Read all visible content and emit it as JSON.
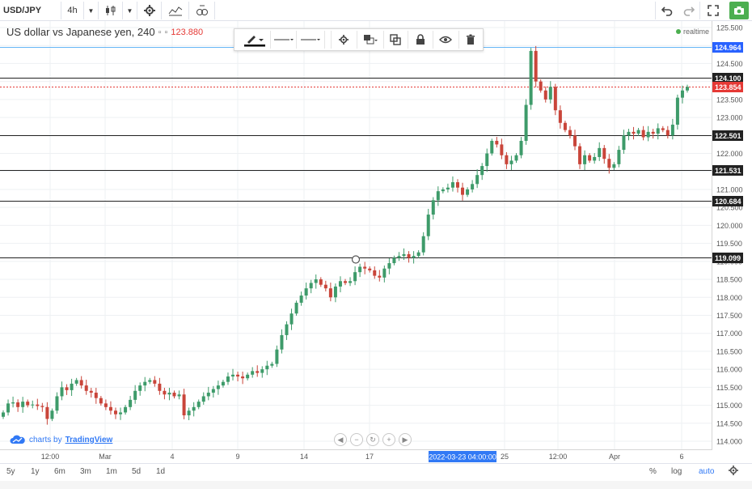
{
  "toolbar": {
    "symbol": "USD/JPY",
    "resolution": "4h"
  },
  "header": {
    "title": "US dollar vs Japanese yen, 240",
    "last_price": "123.880",
    "realtime": "realtime"
  },
  "watermark": {
    "prefix": "charts by",
    "brand": "TradingView"
  },
  "date_badge": "2022-03-23 04:00:00",
  "bottom": {
    "ranges": [
      "5y",
      "1y",
      "6m",
      "3m",
      "1m",
      "5d",
      "1d"
    ],
    "percent": "%",
    "log": "log",
    "auto": "auto"
  },
  "colors": {
    "up": "#3e9b6a",
    "down": "#c9453a",
    "accent": "#3179f5",
    "snapshot": "#4caf50"
  },
  "chart_data": {
    "type": "candlestick",
    "symbol": "USD/JPY",
    "interval": "240",
    "ylim": [
      113.85,
      125.6
    ],
    "yticks": [
      "125.500",
      "125.000",
      "124.500",
      "124.000",
      "123.500",
      "123.000",
      "122.500",
      "122.000",
      "121.500",
      "121.000",
      "120.500",
      "120.000",
      "119.500",
      "119.000",
      "118.500",
      "118.000",
      "117.500",
      "117.000",
      "116.500",
      "116.000",
      "115.500",
      "115.000",
      "114.500",
      "114.000"
    ],
    "xticks": [
      "12:00",
      "Mar",
      "4",
      "9",
      "14",
      "17",
      "25",
      "12:00",
      "Apr",
      "6"
    ],
    "horizontal_lines": [
      {
        "value": 124.964,
        "label": "124.964",
        "style": "blue"
      },
      {
        "value": 124.1,
        "label": "124.100",
        "style": "dark"
      },
      {
        "value": 123.854,
        "label": "123.854",
        "style": "last"
      },
      {
        "value": 122.501,
        "label": "122.501",
        "style": "dark"
      },
      {
        "value": 121.531,
        "label": "121.531",
        "style": "dark"
      },
      {
        "value": 120.684,
        "label": "120.684",
        "style": "dark"
      },
      {
        "value": 119.099,
        "label": "119.099",
        "style": "dark"
      }
    ],
    "closes": [
      114.8,
      115.05,
      115.08,
      114.95,
      115.1,
      115.0,
      115.02,
      114.98,
      114.95,
      114.62,
      114.85,
      115.25,
      115.5,
      115.42,
      115.6,
      115.7,
      115.55,
      115.4,
      115.35,
      115.2,
      115.05,
      114.95,
      114.85,
      114.75,
      114.8,
      114.95,
      115.15,
      115.4,
      115.55,
      115.65,
      115.7,
      115.6,
      115.4,
      115.3,
      115.35,
      115.25,
      115.3,
      114.72,
      114.85,
      114.95,
      115.1,
      115.25,
      115.35,
      115.45,
      115.55,
      115.65,
      115.8,
      115.85,
      115.8,
      115.75,
      115.85,
      115.95,
      115.9,
      116.0,
      116.1,
      116.15,
      116.55,
      116.95,
      117.25,
      117.55,
      117.85,
      118.05,
      118.25,
      118.4,
      118.5,
      118.35,
      118.25,
      118.0,
      118.3,
      118.45,
      118.4,
      118.45,
      118.7,
      118.85,
      118.8,
      118.75,
      118.6,
      118.55,
      118.8,
      118.95,
      119.1,
      119.15,
      119.2,
      119.1,
      119.15,
      119.25,
      119.7,
      120.3,
      120.7,
      120.95,
      121.0,
      121.05,
      121.2,
      121.05,
      120.85,
      121.0,
      121.15,
      121.4,
      121.65,
      122.0,
      122.35,
      122.25,
      121.95,
      121.7,
      121.8,
      121.95,
      122.35,
      123.35,
      124.85,
      124.0,
      123.75,
      123.5,
      123.85,
      123.2,
      122.85,
      122.65,
      122.5,
      122.2,
      121.7,
      121.95,
      121.8,
      121.9,
      122.15,
      121.85,
      121.6,
      121.7,
      122.1,
      122.5,
      122.6,
      122.55,
      122.65,
      122.45,
      122.6,
      122.55,
      122.7,
      122.65,
      122.5,
      122.8,
      123.55,
      123.75,
      123.85
    ]
  }
}
